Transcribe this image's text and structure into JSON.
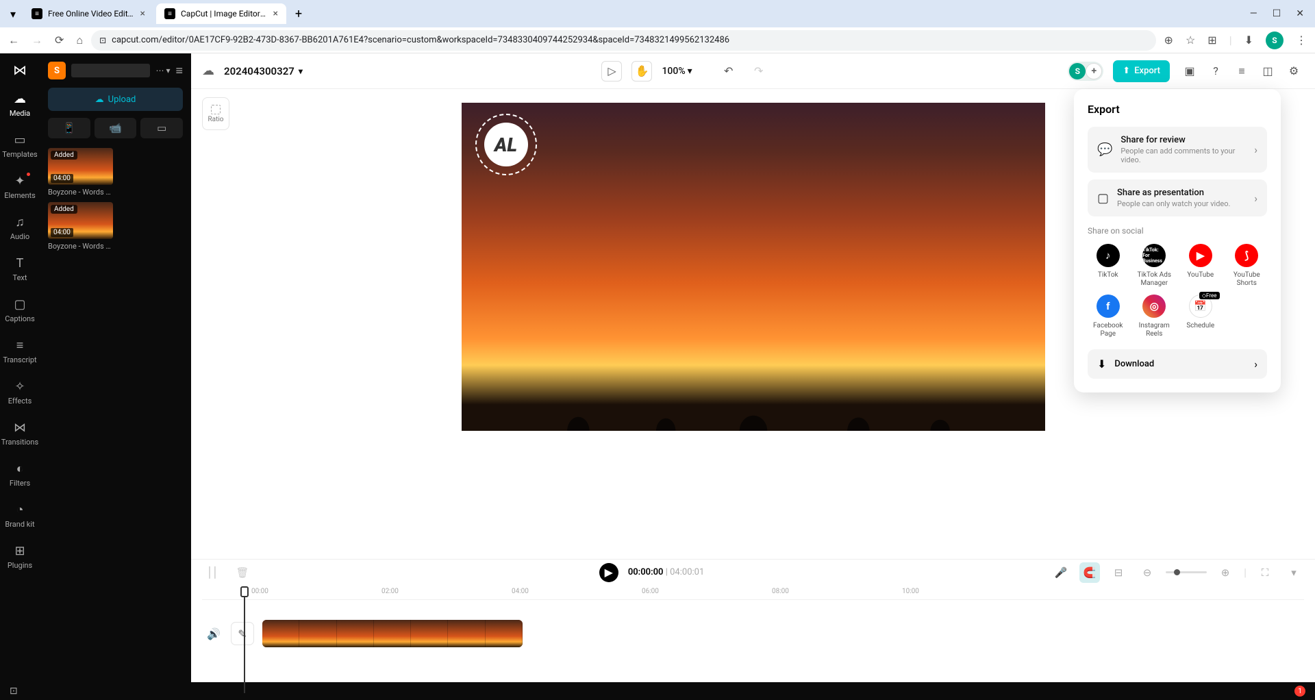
{
  "browser": {
    "tab1": "Free Online Video Editor | Easy",
    "tab2": "CapCut | Image Editor | All-In-O",
    "url": "capcut.com/editor/0AE17CF9-92B2-473D-8367-BB6201A761E4?scenario=custom&workspaceId=7348330409744252934&spaceId=7348321499562132486"
  },
  "nav": {
    "media": "Media",
    "templates": "Templates",
    "elements": "Elements",
    "audio": "Audio",
    "text": "Text",
    "captions": "Captions",
    "transcript": "Transcript",
    "effects": "Effects",
    "transitions": "Transitions",
    "filters": "Filters",
    "brandkit": "Brand kit",
    "plugins": "Plugins"
  },
  "side": {
    "user_initial": "S",
    "upload": "Upload",
    "thumbs": [
      {
        "added": "Added",
        "dur": "04:00",
        "name": "Boyzone - Words (..."
      },
      {
        "added": "Added",
        "dur": "04:00",
        "name": "Boyzone - Words (..."
      }
    ]
  },
  "head": {
    "project": "202404300327",
    "zoom": "100%",
    "export": "Export",
    "ratio": "Ratio"
  },
  "logo_text": "AL",
  "export_panel": {
    "title": "Export",
    "review_t": "Share for review",
    "review_s": "People can add comments to your video.",
    "present_t": "Share as presentation",
    "present_s": "People can only watch your video.",
    "social_label": "Share on social",
    "socials": {
      "tiktok": "TikTok",
      "ttads": "TikTok Ads Manager",
      "youtube": "YouTube",
      "shorts": "YouTube Shorts",
      "fb": "Facebook Page",
      "insta": "Instagram Reels",
      "schedule": "Schedule",
      "free": "◇Free"
    },
    "download": "Download"
  },
  "timeline": {
    "current": "00:00:00",
    "total": "04:00:01",
    "ticks": [
      "00:00",
      "02:00",
      "04:00",
      "06:00",
      "08:00",
      "10:00"
    ]
  },
  "notif_count": "1"
}
